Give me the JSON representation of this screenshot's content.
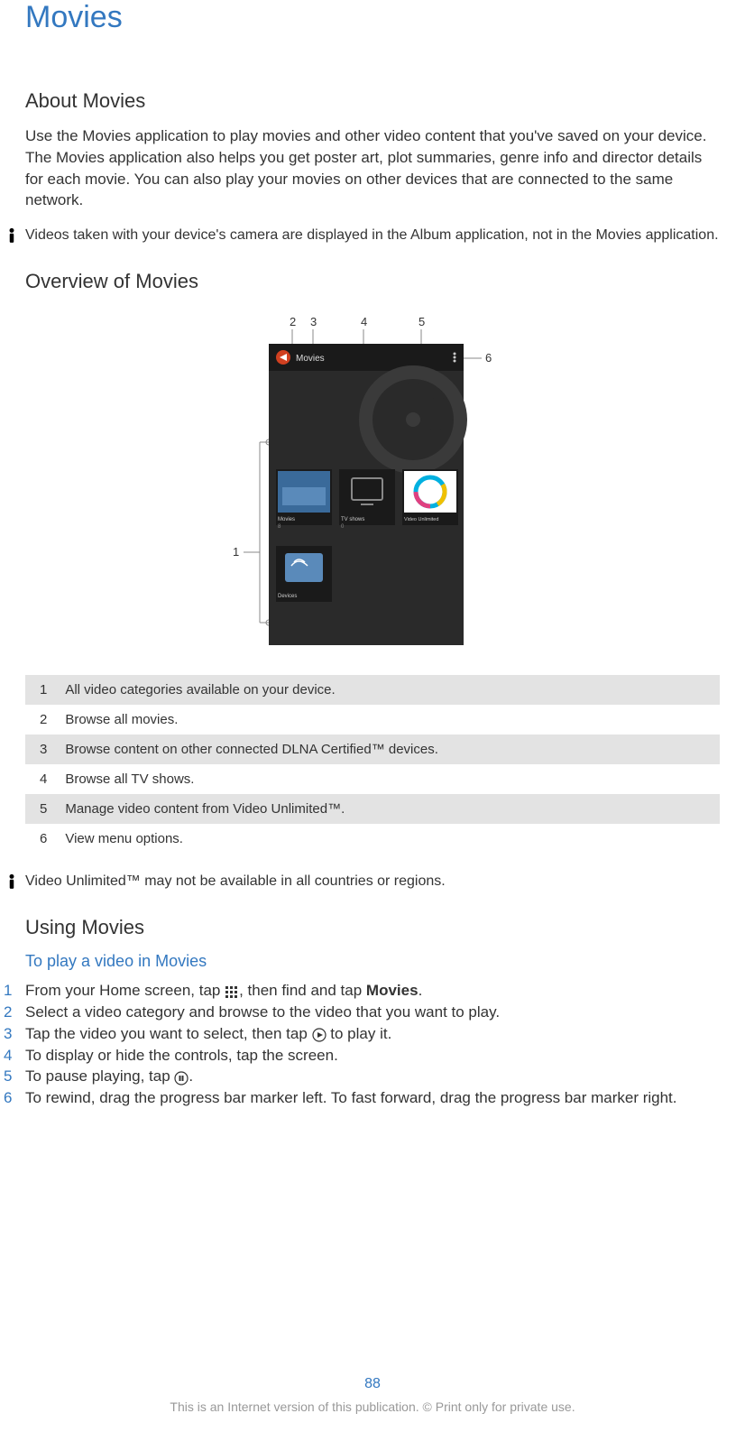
{
  "main_title": "Movies",
  "about": {
    "title": "About Movies",
    "text": "Use the Movies application to play movies and other video content that you've saved on your device. The Movies application also helps you get poster art, plot summaries, genre info and director details for each movie. You can also play your movies on other devices that are connected to the same network."
  },
  "warning1": "Videos taken with your device's camera are displayed in the Album application, not in the Movies application.",
  "overview_title": "Overview of Movies",
  "screenshot": {
    "header_label": "Movies",
    "tile_movies": "Movies",
    "tile_movies_count": "8",
    "tile_tvshows": "TV shows",
    "tile_tvshows_count": "0",
    "tile_video_unlimited": "Video Unlimited",
    "tile_devices": "Devices"
  },
  "overview_table": [
    {
      "num": "1",
      "desc": "All video categories available on your device."
    },
    {
      "num": "2",
      "desc": "Browse all movies."
    },
    {
      "num": "3",
      "desc": "Browse content on other connected DLNA Certified™ devices."
    },
    {
      "num": "4",
      "desc": "Browse all TV shows."
    },
    {
      "num": "5",
      "desc": "Manage video content from Video Unlimited™."
    },
    {
      "num": "6",
      "desc": "View menu options."
    }
  ],
  "warning2": "Video Unlimited™ may not be available in all countries or regions.",
  "using_title": "Using Movies",
  "play_heading": "To play a video in Movies",
  "steps": [
    {
      "num": "1",
      "text_before": "From your Home screen, tap ",
      "icon": "apps",
      "text_mid": ", then find and tap ",
      "bold": "Movies",
      "text_after": "."
    },
    {
      "num": "2",
      "text": "Select a video category and browse to the video that you want to play."
    },
    {
      "num": "3",
      "text_before": "Tap the video you want to select, then tap ",
      "icon": "play",
      "text_after": " to play it."
    },
    {
      "num": "4",
      "text": "To display or hide the controls, tap the screen."
    },
    {
      "num": "5",
      "text_before": "To pause playing, tap ",
      "icon": "pause",
      "text_after": "."
    },
    {
      "num": "6",
      "text": "To rewind, drag the progress bar marker left. To fast forward, drag the progress bar marker right."
    }
  ],
  "page_num": "88",
  "footer_note": "This is an Internet version of this publication. © Print only for private use."
}
